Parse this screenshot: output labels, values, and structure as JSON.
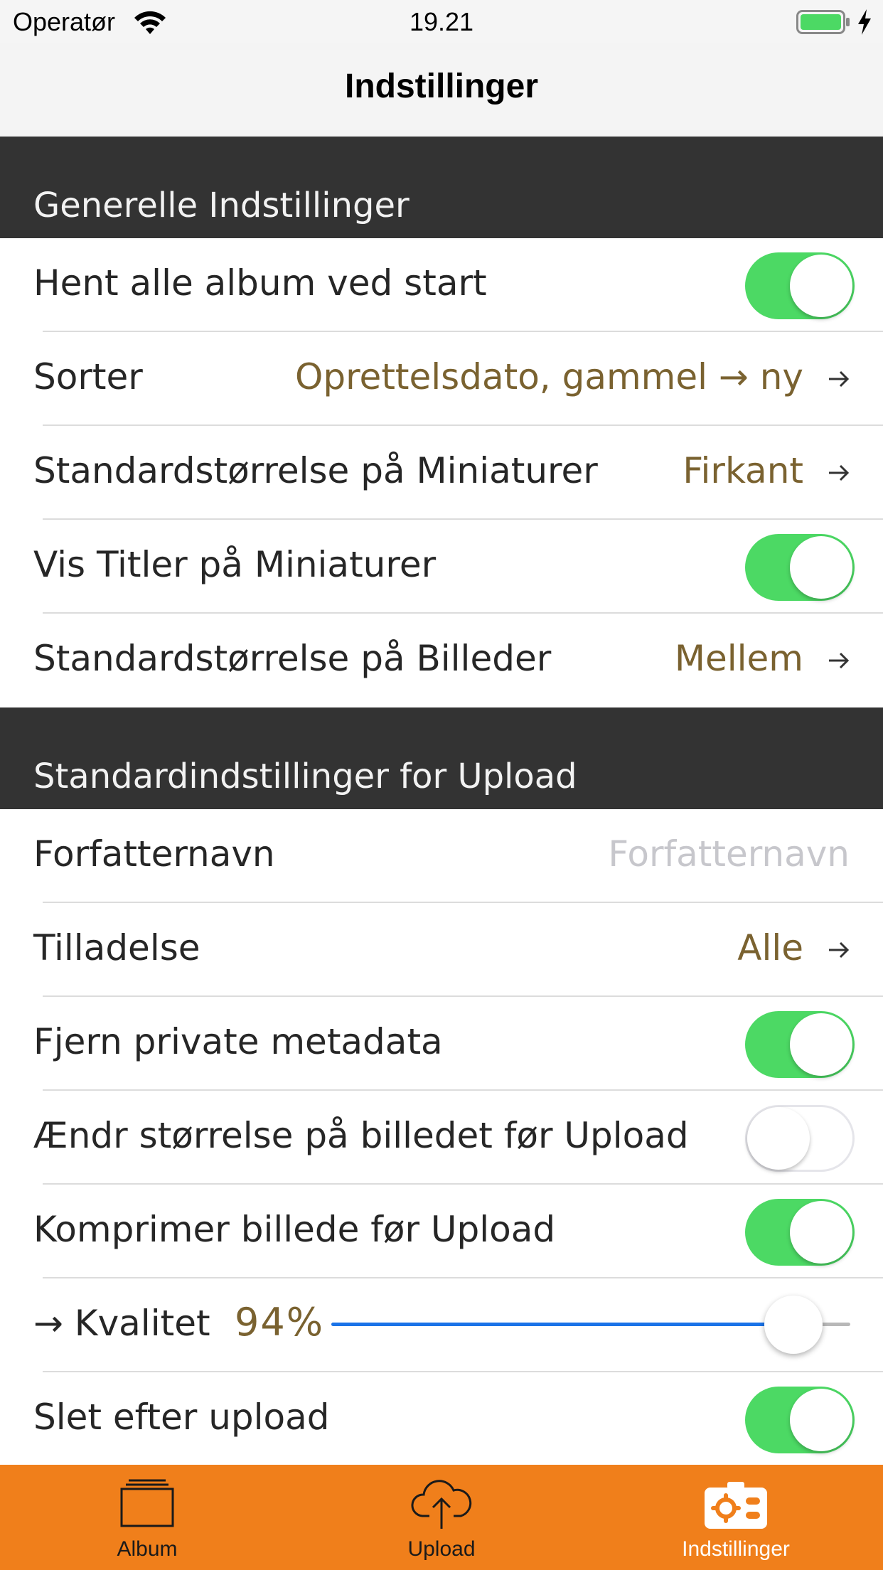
{
  "status_bar": {
    "carrier": "Operatør",
    "time": "19.21"
  },
  "nav": {
    "title": "Indstillinger"
  },
  "sections": {
    "general": {
      "header": "Generelle Indstillinger",
      "rows": {
        "load_all": {
          "label": "Hent alle album ved start",
          "toggle": true
        },
        "sort": {
          "label": "Sorter",
          "value": "Oprettelsdato, gammel → ny"
        },
        "thumb_size": {
          "label": "Standardstørrelse på Miniaturer",
          "value": "Firkant"
        },
        "show_titles": {
          "label": "Vis Titler på Miniaturer",
          "toggle": true
        },
        "image_size": {
          "label": "Standardstørrelse på Billeder",
          "value": "Mellem"
        }
      }
    },
    "upload": {
      "header": "Standardindstillinger for Upload",
      "rows": {
        "author": {
          "label": "Forfatternavn",
          "placeholder": "Forfatternavn"
        },
        "permission": {
          "label": "Tilladelse",
          "value": "Alle"
        },
        "strip_metadata": {
          "label": "Fjern private metadata",
          "toggle": true
        },
        "resize": {
          "label": "Ændr størrelse på billedet før Upload",
          "toggle": false
        },
        "compress": {
          "label": "Komprimer billede før Upload",
          "toggle": true
        },
        "quality": {
          "label": "→ Kvalitet",
          "value": "94%",
          "slider_fraction": 0.94
        },
        "delete_after": {
          "label": "Slet efter upload",
          "toggle": true
        }
      }
    }
  },
  "tabbar": {
    "tabs": [
      {
        "label": "Album",
        "icon": "album-icon"
      },
      {
        "label": "Upload",
        "icon": "cloud-upload-icon"
      },
      {
        "label": "Indstillinger",
        "icon": "settings-icon",
        "active": true
      }
    ]
  },
  "colors": {
    "accent_orange": "#f07f1b",
    "value_text": "#7a6230",
    "toggle_on": "#4cd964",
    "slider_blue": "#1a73e8",
    "section_header_bg": "#333333"
  }
}
